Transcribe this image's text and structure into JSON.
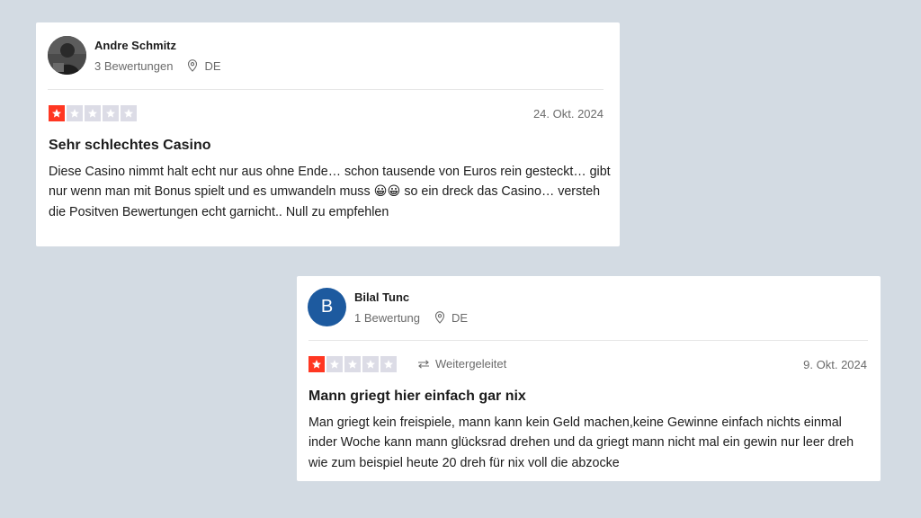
{
  "reviews": [
    {
      "user_name": "Andre Schmitz",
      "review_count": "3 Bewertungen",
      "country": "DE",
      "rating": 1,
      "forwarded": "",
      "date": "24. Okt. 2024",
      "title": "Sehr schlechtes Casino",
      "body": "Diese Casino nimmt halt echt nur aus ohne Ende… schon tausende von Euros rein gesteckt… gibt nur wenn man mit Bonus spielt und es umwandeln muss 😀😀 so ein dreck das Casino… versteh die Positven Bewertungen echt garnicht.. Null zu empfehlen"
    },
    {
      "user_name": "Bilal Tunc",
      "avatar_letter": "B",
      "review_count": "1 Bewertung",
      "country": "DE",
      "rating": 1,
      "forwarded": "Weitergeleitet",
      "date": "9. Okt. 2024",
      "title": "Mann griegt hier einfach gar nix",
      "body": "Man griegt kein freispiele, mann kann kein Geld machen,keine Gewinne einfach nichts einmal inder Woche kann mann glücksrad drehen und da griegt mann nicht mal ein gewin nur leer dreh wie zum beispiel heute 20 dreh für nix voll die abzocke"
    }
  ],
  "colors": {
    "background": "#d3dbe3",
    "star_filled": "#ff3722",
    "star_empty": "#dcdce6",
    "avatar_blue": "#1d5a9f"
  },
  "icons": [
    "location-pin-icon",
    "star-icon",
    "forward-arrow-icon",
    "user-photo-avatar"
  ]
}
